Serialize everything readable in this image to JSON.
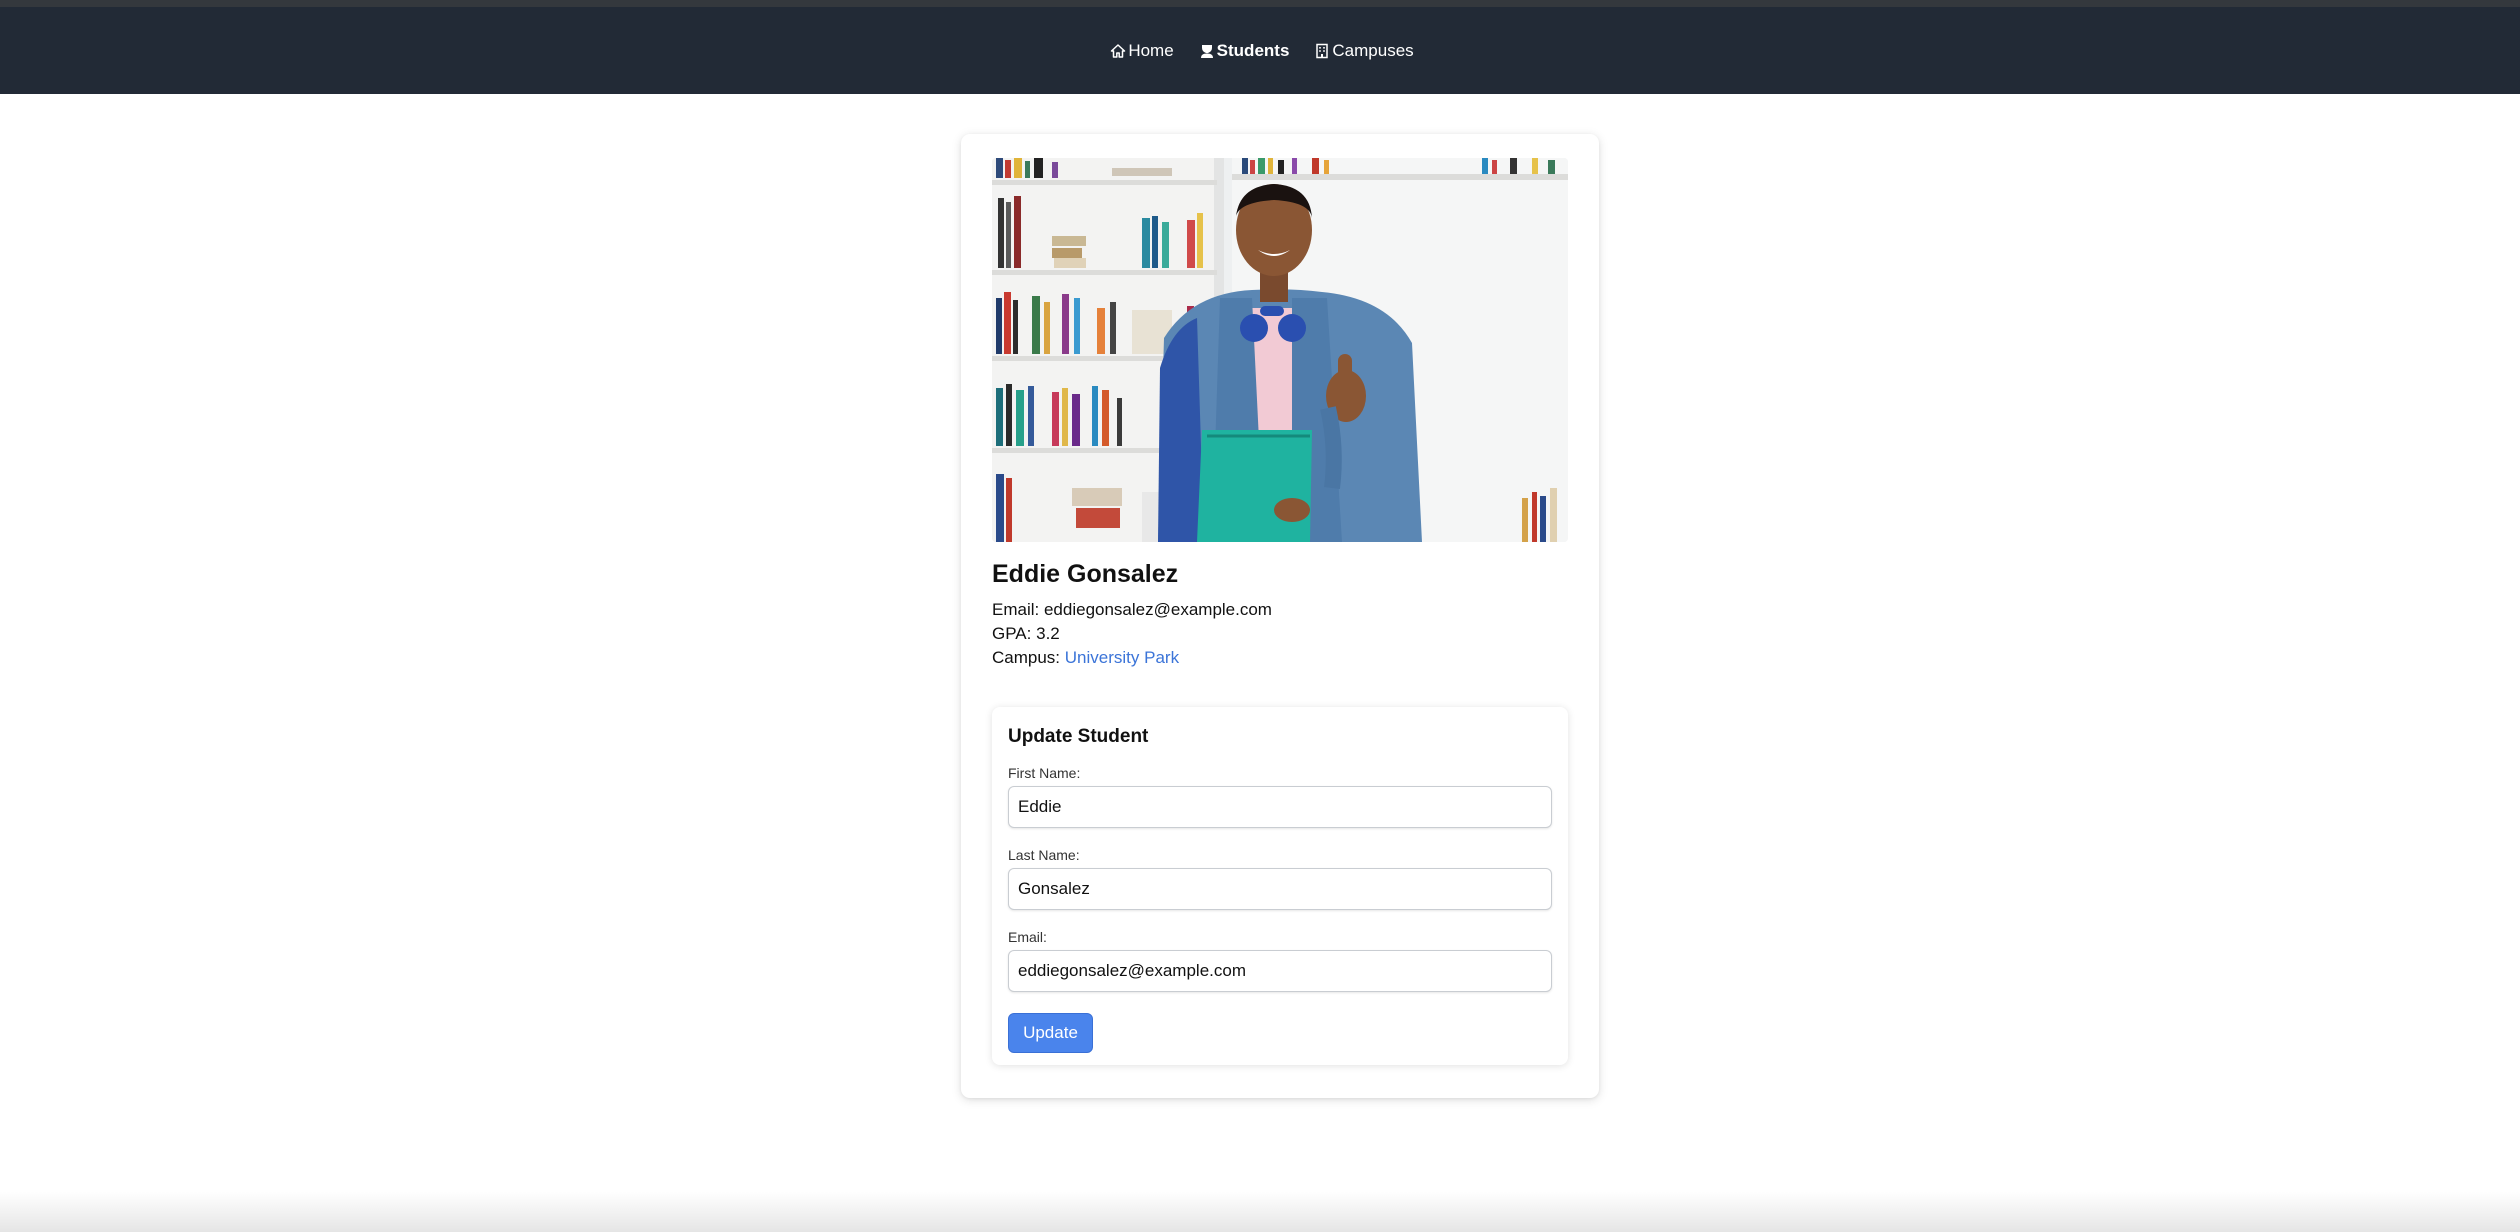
{
  "nav": {
    "items": [
      {
        "label": "Home",
        "icon": "home-icon",
        "active": false
      },
      {
        "label": "Students",
        "icon": "student-icon",
        "active": true
      },
      {
        "label": "Campuses",
        "icon": "building-icon",
        "active": false
      }
    ]
  },
  "student": {
    "photo_alt": "student photo",
    "name": "Eddie Gonsalez",
    "email_label": "Email:",
    "email": "eddiegonsalez@example.com",
    "gpa_label": "GPA:",
    "gpa": "3.2",
    "campus_label": "Campus:",
    "campus": "University Park"
  },
  "form": {
    "title": "Update Student",
    "first_name_label": "First Name:",
    "first_name_value": "Eddie",
    "last_name_label": "Last Name:",
    "last_name_value": "Gonsalez",
    "email_label": "Email:",
    "email_value": "eddiegonsalez@example.com",
    "submit_label": "Update"
  },
  "colors": {
    "navbar": "#222a36",
    "link": "#3b74d8",
    "button": "#4a84ec"
  }
}
